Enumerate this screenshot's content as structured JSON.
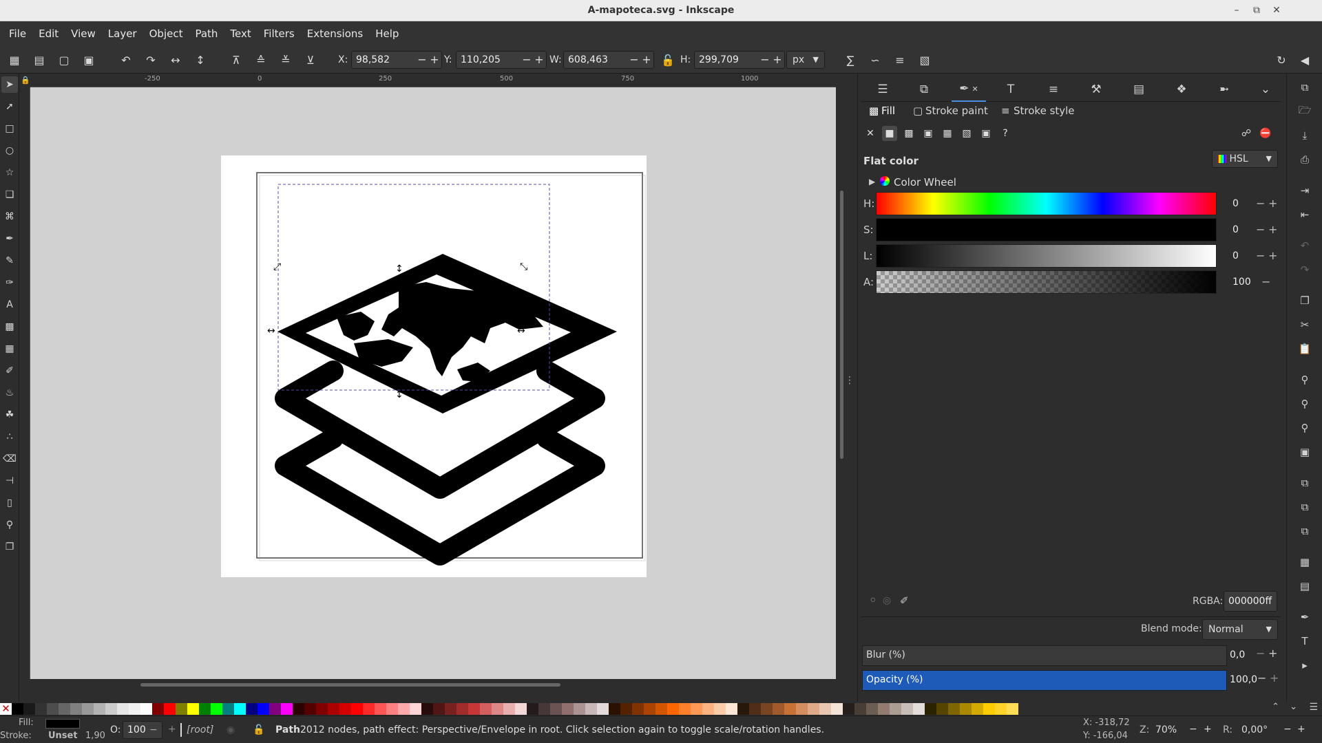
{
  "window": {
    "title": "A-mapoteca.svg - Inkscape"
  },
  "menu": [
    "File",
    "Edit",
    "View",
    "Layer",
    "Object",
    "Path",
    "Text",
    "Filters",
    "Extensions",
    "Help"
  ],
  "controls": {
    "x_label": "X:",
    "x_value": "98,582",
    "y_label": "Y:",
    "y_value": "110,205",
    "w_label": "W:",
    "w_value": "608,463",
    "h_label": "H:",
    "h_value": "299,709",
    "unit": "px"
  },
  "ruler": {
    "h_ticks": [
      "-250",
      "0",
      "250",
      "500",
      "750",
      "1000"
    ]
  },
  "fill_stroke": {
    "tabs": [
      "Fill",
      "Stroke paint",
      "Stroke style"
    ],
    "mode_label": "Flat color",
    "color_model": "HSL",
    "color_wheel_label": "Color Wheel",
    "channels": [
      {
        "name": "H:",
        "value": "0"
      },
      {
        "name": "S:",
        "value": "0"
      },
      {
        "name": "L:",
        "value": "0"
      },
      {
        "name": "A:",
        "value": "100"
      }
    ],
    "rgba_label": "RGBA:",
    "rgba_value": "000000ff",
    "blend_label": "Blend mode:",
    "blend_value": "Normal",
    "blur_label": "Blur (%)",
    "blur_value": "0,0",
    "opacity_label": "Opacity (%)",
    "opacity_value": "100,0",
    "opacity_fraction": 1.0
  },
  "status": {
    "fill_label": "Fill:",
    "stroke_label": "Stroke:",
    "stroke_value": "Unset",
    "stroke_width": "1,90",
    "opacity_label": "O:",
    "opacity_value": "100",
    "layer": "[root]",
    "message_bold": "Path",
    "message": " 2012 nodes, path effect: Perspective/Envelope in root. Click selection again to toggle scale/rotation handles.",
    "cursor_x": "X: -318,72",
    "cursor_y": "Y: -166,04",
    "zoom_label": "Z:",
    "zoom_value": "70%",
    "rotation_label": "R:",
    "rotation_value": "0,00°"
  },
  "colors": {
    "accent": "#1e5bb8",
    "canvas_bg": "#d1d1d1",
    "ui_bg": "#2d2d2d"
  },
  "palette": [
    "#000000",
    "#1a1a1a",
    "#333333",
    "#4d4d4d",
    "#666666",
    "#808080",
    "#999999",
    "#b3b3b3",
    "#cccccc",
    "#e6e6e6",
    "#f2f2f2",
    "#ffffff",
    "#800000",
    "#ff0000",
    "#808000",
    "#ffff00",
    "#008000",
    "#00ff00",
    "#008080",
    "#00ffff",
    "#000080",
    "#0000ff",
    "#800080",
    "#ff00ff",
    "#2b0000",
    "#550000",
    "#800000",
    "#aa0000",
    "#d40000",
    "#ff0000",
    "#ff2a2a",
    "#ff5555",
    "#ff8080",
    "#ffaaaa",
    "#ffd5d5",
    "#280b0b",
    "#501616",
    "#782121",
    "#a02c2c",
    "#c83737",
    "#d35f5f",
    "#de8787",
    "#e9afaf",
    "#f4d7d7",
    "#241c1c",
    "#483737",
    "#6c5353",
    "#916f6f",
    "#ac9393",
    "#c8b7b7",
    "#e3dbdb",
    "#2b1100",
    "#552200",
    "#803300",
    "#aa4400",
    "#d45500",
    "#ff6600",
    "#ff7f2a",
    "#ff9955",
    "#ffb380",
    "#ffccaa",
    "#ffe6d5",
    "#28170b",
    "#502d16",
    "#784421",
    "#a05a2c",
    "#c87137",
    "#d38d5f",
    "#deaa87",
    "#e9c6af",
    "#f4e3d7",
    "#241f1c",
    "#483e37",
    "#6c5d53",
    "#917c6f",
    "#ac9d93",
    "#c8beb7",
    "#e3dedb",
    "#2b2200",
    "#554400",
    "#806600",
    "#aa8800",
    "#d4aa00",
    "#ffcc00",
    "#ffd42a",
    "#ffdd55",
    "#ffe680",
    "#ffeeaa",
    "#fff6d5",
    "#28220b",
    "#504416",
    "#786721",
    "#a0892c",
    "#c8ab37",
    "#d3bc5f",
    "#decd87",
    "#e9ddaf",
    "#f4eed7",
    "#24221c",
    "#484537",
    "#6c6753",
    "#918a6f",
    "#aca793",
    "#c8c4b7",
    "#e3e2db",
    "#222b00",
    "#445500",
    "#668000"
  ]
}
